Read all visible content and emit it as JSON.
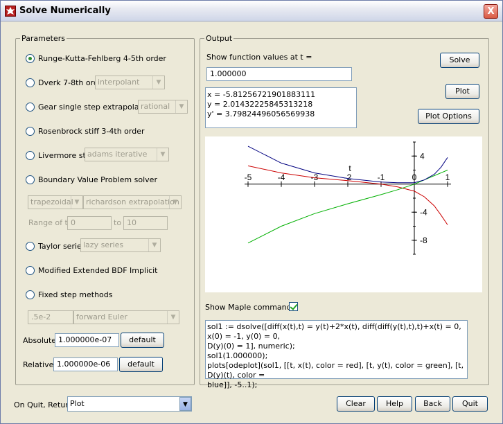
{
  "window": {
    "title": "Solve Numerically",
    "close_label": "X"
  },
  "parameters": {
    "legend": "Parameters",
    "methods": [
      {
        "label": "Runge-Kutta-Fehlberg 4-5th order",
        "selected": true
      },
      {
        "label": "Dverk 7-8th order",
        "option": "interpolant"
      },
      {
        "label": "Gear single step extrapolation",
        "option": "rational"
      },
      {
        "label": "Rosenbrock stiff 3-4th order"
      },
      {
        "label": "Livermore stiff",
        "option": "adams iterative"
      },
      {
        "label": "Boundary Value Problem solver"
      },
      {
        "label": "Taylor series",
        "option": "lazy series"
      },
      {
        "label": "Modified Extended BDF Implicit"
      },
      {
        "label": "Fixed step methods"
      }
    ],
    "bvp_method": "trapezoidal",
    "bvp_extrapolation": "richardson extrapolation",
    "range_label": "Range of t:",
    "range_from": "0",
    "range_to_label": "to",
    "range_to": "10",
    "step_size": ".5e-2",
    "fixed_method": "forward Euler",
    "absolute_label": "Absolute:",
    "absolute_value": "1.000000e-07",
    "relative_label": "Relative:",
    "relative_value": "1.000000e-06",
    "default_label": "default"
  },
  "output": {
    "legend": "Output",
    "show_values_label": "Show function values at t =",
    "t_value": "1.000000",
    "values": [
      "x = -5.81256721901883111",
      "y = 2.01432225845313218",
      "y' = 3.79824496056569938"
    ],
    "solve_label": "Solve",
    "plot_label": "Plot",
    "plot_options_label": "Plot Options",
    "show_maple_label": "Show Maple commands",
    "show_maple_checked": true,
    "maple_commands": [
      "sol1 := dsolve([diff(x(t),t) = y(t)+2*x(t), diff(diff(y(t),t),t)+x(t) = 0, x(0) = -1, y(0) = 0,",
      "D(y)(0) = 1], numeric);",
      "sol1(1.000000);",
      "plots[odeplot](sol1, [[t, x(t), color = red], [t, y(t), color = green], [t, D(y)(t), color =",
      "blue]], -5..1);"
    ]
  },
  "chart_data": {
    "type": "line",
    "xlabel": "t",
    "xlim": [
      -5,
      1
    ],
    "ylim": [
      -10,
      6
    ],
    "x_ticks": [
      "-5",
      "-4",
      "-3",
      "-2",
      "-1",
      "0",
      "1"
    ],
    "y_ticks": [
      "4",
      "-4",
      "-8"
    ],
    "series": [
      {
        "color": "#cc0000",
        "x": [
          -5,
          -4,
          -3,
          -2,
          -1,
          -0.5,
          0,
          0.3,
          0.6,
          0.8,
          1
        ],
        "y": [
          2.6,
          1.6,
          0.9,
          0.5,
          0.0,
          -0.4,
          -1.0,
          -1.8,
          -3.1,
          -4.4,
          -5.8
        ]
      },
      {
        "color": "#00b000",
        "x": [
          -5,
          -4,
          -3,
          -2,
          -1,
          -0.5,
          0,
          0.5,
          1
        ],
        "y": [
          -8.4,
          -6.0,
          -4.2,
          -2.8,
          -1.5,
          -0.8,
          0.0,
          1.0,
          2.0
        ]
      },
      {
        "color": "#000080",
        "x": [
          -5,
          -4,
          -3,
          -2,
          -1,
          -0.5,
          0,
          0.3,
          0.6,
          0.8,
          1
        ],
        "y": [
          5.4,
          3.0,
          1.6,
          0.8,
          0.3,
          0.2,
          0.2,
          0.6,
          1.4,
          2.4,
          3.8
        ]
      }
    ]
  },
  "footer": {
    "on_quit_label": "On Quit, Return",
    "on_quit_value": "Plot",
    "clear_label": "Clear",
    "help_label": "Help",
    "back_label": "Back",
    "quit_label": "Quit"
  }
}
